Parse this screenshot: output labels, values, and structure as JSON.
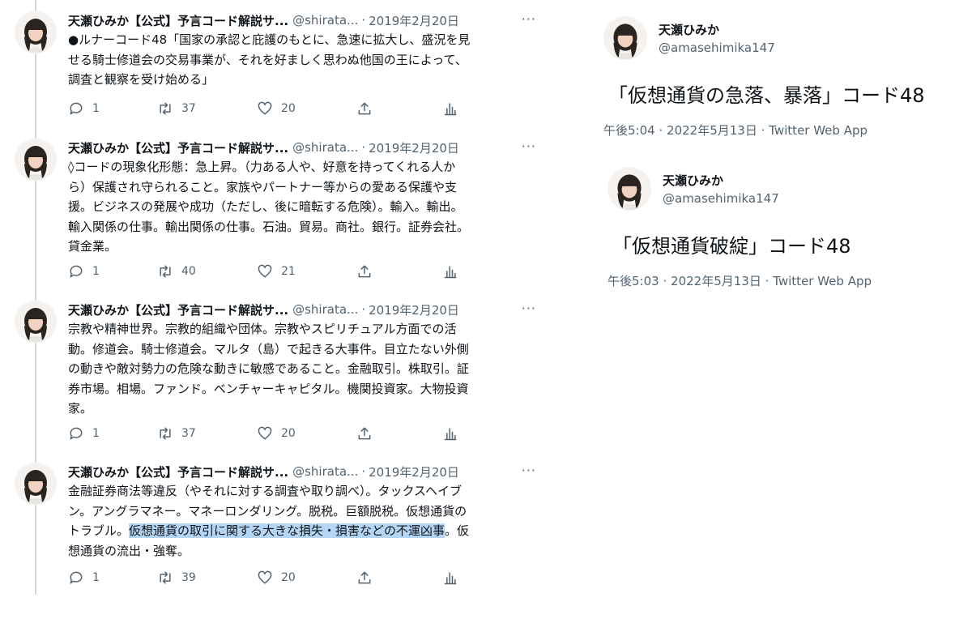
{
  "thread": {
    "tweets": [
      {
        "name": "天瀬ひみか【公式】予言コード解説サ...",
        "handle": "@shirata...",
        "date": "2019年2月20日",
        "more": "···",
        "text_parts": [
          "●ルナーコード48「国家の承認と庇護のもとに、急速に拡大し、盛況を見\nせる騎士修道会の交易事業が、それを好ましく思わぬ他国の王によって、\n調査と観察を受け始める」",
          "",
          ""
        ],
        "replies": "1",
        "retweets": "37",
        "likes": "20"
      },
      {
        "name": "天瀬ひみか【公式】予言コード解説サ...",
        "handle": "@shirata...",
        "date": "2019年2月20日",
        "more": "···",
        "text_parts": [
          "◊コードの現象化形態：急上昇。（力ある人や、好意を持ってくれる人か\nら）保護され守られること。家族やパートナー等からの愛ある保護や支\n援。ビジネスの発展や成功（ただし、後に暗転する危険）。輸入。輸出。\n輸入関係の仕事。輸出関係の仕事。石油。貿易。商社。銀行。証券会社。\n貸金業。",
          "",
          ""
        ],
        "replies": "1",
        "retweets": "40",
        "likes": "21"
      },
      {
        "name": "天瀬ひみか【公式】予言コード解説サ...",
        "handle": "@shirata...",
        "date": "2019年2月20日",
        "more": "···",
        "text_parts": [
          "宗教や精神世界。宗教的組織や団体。宗教やスピリチュアル方面での活\n動。修道会。騎士修道会。マルタ（島）で起きる大事件。目立たない外側\nの動きや敵対勢力の危険な動きに敏感であること。金融取引。株取引。証\n券市場。相場。ファンド。ベンチャーキャピタル。機関投資家。大物投資\n家。",
          "",
          ""
        ],
        "replies": "1",
        "retweets": "37",
        "likes": "20"
      },
      {
        "name": "天瀬ひみか【公式】予言コード解説サ...",
        "handle": "@shirata...",
        "date": "2019年2月20日",
        "more": "···",
        "text_parts": [
          "金融証券商法等違反（やそれに対する調査や取り調べ）。タックスヘイブ\nン。アングラマネー。マネーロンダリング。脱税。巨額脱税。仮想通貨の\nトラブル。",
          "仮想通貨の取引に関する大きな損失・損害などの不運凶事",
          "。仮\n想通貨の流出・強奪。"
        ],
        "replies": "1",
        "retweets": "39",
        "likes": "20"
      }
    ]
  },
  "cards": [
    {
      "name": "天瀬ひみか",
      "handle": "@amasehimika147",
      "body": "「仮想通貨の急落、暴落」コード48",
      "time": "午後5:04",
      "date": "2022年5月13日",
      "source": "Twitter Web App"
    },
    {
      "name": "天瀬ひみか",
      "handle": "@amasehimika147",
      "body": "「仮想通貨破綻」コード48",
      "time": "午後5:03",
      "date": "2022年5月13日",
      "source": "Twitter Web App"
    }
  ],
  "meta_separator": "·",
  "colors": {
    "text": "#0f1419",
    "secondary": "#536471",
    "highlight": "#b5d5f5",
    "thread_line": "#cfd9de"
  },
  "icons": [
    "reply-icon",
    "retweet-icon",
    "like-icon",
    "share-icon",
    "analytics-icon",
    "more-icon"
  ]
}
